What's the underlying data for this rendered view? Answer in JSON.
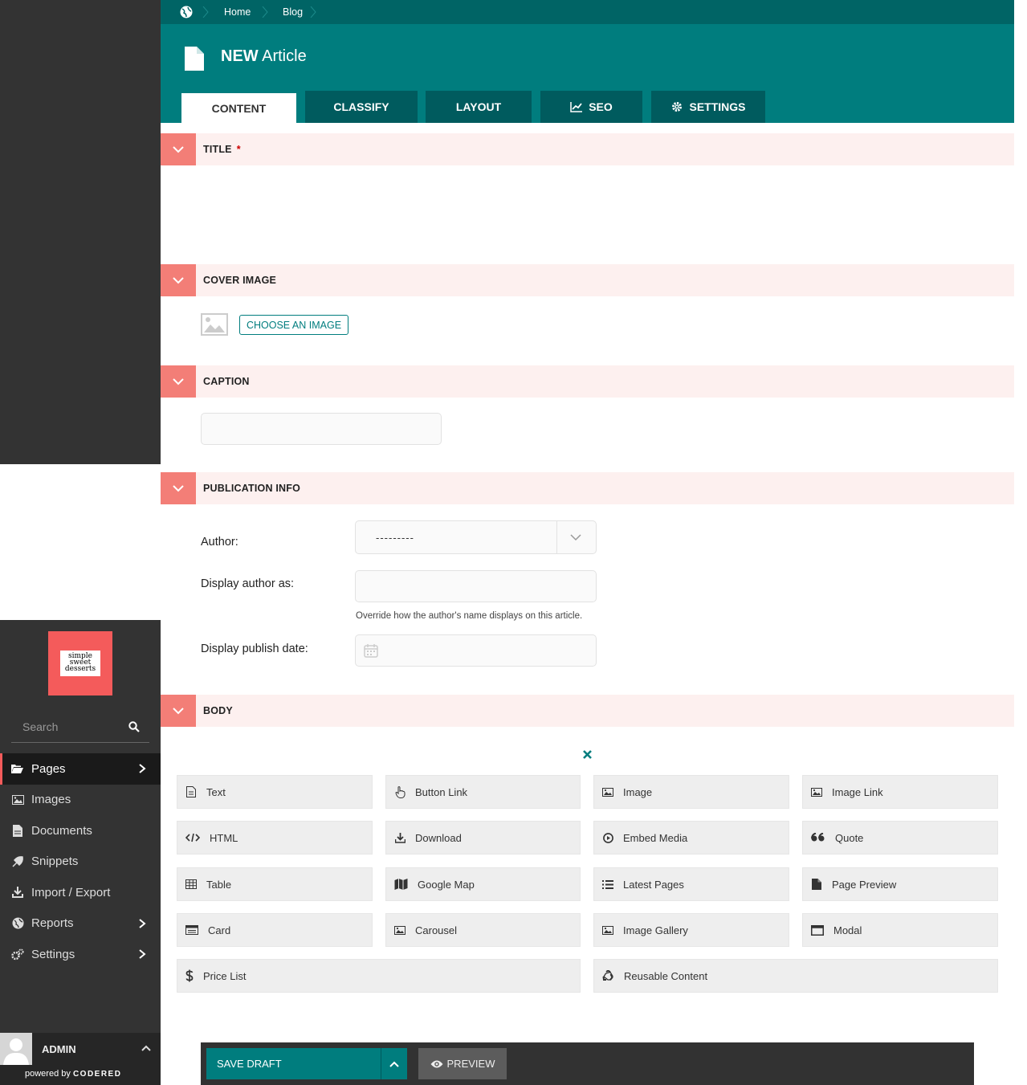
{
  "sidebar": {
    "logo_text": [
      "simple",
      "sweet",
      "desserts"
    ],
    "search_placeholder": "Search",
    "items": [
      {
        "label": "Pages",
        "icon": "folder-open-icon",
        "active": true,
        "has_submenu": true
      },
      {
        "label": "Images",
        "icon": "image-icon",
        "active": false,
        "has_submenu": false
      },
      {
        "label": "Documents",
        "icon": "document-icon",
        "active": false,
        "has_submenu": false
      },
      {
        "label": "Snippets",
        "icon": "snippet-icon",
        "active": false,
        "has_submenu": false
      },
      {
        "label": "Import / Export",
        "icon": "download-icon",
        "active": false,
        "has_submenu": false
      },
      {
        "label": "Reports",
        "icon": "globe-icon",
        "active": false,
        "has_submenu": true
      },
      {
        "label": "Settings",
        "icon": "cogs-icon",
        "active": false,
        "has_submenu": true
      }
    ],
    "account_name": "ADMIN",
    "powered_by": "powered by",
    "powered_brand": "CODERED"
  },
  "header": {
    "breadcrumb": [
      "Home",
      "Blog"
    ],
    "title_bold": "NEW",
    "title_rest": " Article",
    "tabs": [
      "CONTENT",
      "CLASSIFY",
      "LAYOUT",
      "SEO",
      "SETTINGS"
    ],
    "active_tab": "CONTENT"
  },
  "sections": {
    "title": {
      "label": "TITLE",
      "required_mark": "*"
    },
    "cover_image": {
      "label": "COVER IMAGE",
      "button": "CHOOSE AN IMAGE"
    },
    "caption": {
      "label": "CAPTION",
      "value": ""
    },
    "publication": {
      "label": "PUBLICATION INFO",
      "author_label": "Author:",
      "author_value": "---------",
      "display_author_label": "Display author as:",
      "display_author_value": "",
      "display_author_help": "Override how the author's name displays on this article.",
      "publish_date_label": "Display publish date:",
      "publish_date_value": ""
    },
    "body": {
      "label": "BODY",
      "blocks": [
        "Text",
        "Button Link",
        "Image",
        "Image Link",
        "HTML",
        "Download",
        "Embed Media",
        "Quote",
        "Table",
        "Google Map",
        "Latest Pages",
        "Page Preview",
        "Card",
        "Carousel",
        "Image Gallery",
        "Modal",
        "Price List",
        "Reusable Content"
      ]
    }
  },
  "footer": {
    "save_label": "SAVE DRAFT",
    "preview_label": "PREVIEW"
  },
  "colors": {
    "teal": "#007d7e",
    "teal_dark": "#006465",
    "salmon": "#f37e77",
    "section_bg": "#fdf0ef",
    "sidebar_bg": "#333333",
    "logo_bg": "#f45b5b"
  }
}
